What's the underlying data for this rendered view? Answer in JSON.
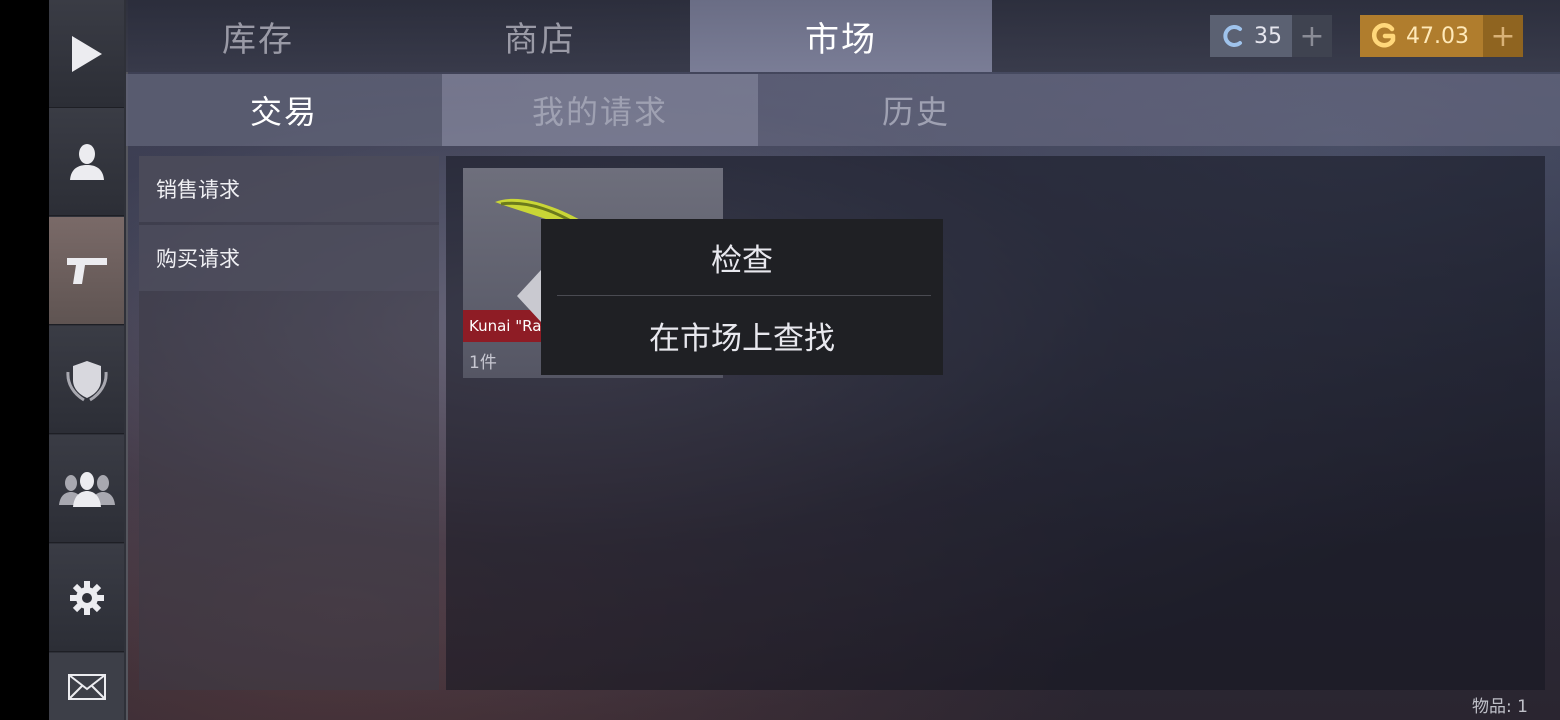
{
  "top_tabs": [
    {
      "label": "库存"
    },
    {
      "label": "商店"
    },
    {
      "label": "市场"
    }
  ],
  "currency": {
    "credits": {
      "value": "35",
      "plus": "+"
    },
    "gold": {
      "value": "47.03",
      "plus": "+"
    }
  },
  "sub_tabs": [
    {
      "label": "交易"
    },
    {
      "label": "我的请求"
    },
    {
      "label": "历史"
    }
  ],
  "sidebar": {
    "icons": [
      "play-icon",
      "profile-icon",
      "pistol-icon",
      "clan-shield-icon",
      "friends-icon",
      "settings-gear-icon",
      "mail-icon"
    ],
    "active_index": 2
  },
  "left_list": [
    {
      "label": "销售请求"
    },
    {
      "label": "购买请求"
    }
  ],
  "item_card": {
    "name": "Kunai \"Ra",
    "count": "1件"
  },
  "context_menu": {
    "items": [
      {
        "label": "检查"
      },
      {
        "label": "在市场上查找"
      }
    ]
  },
  "footer": {
    "item_count": "物品: 1"
  },
  "colors": {
    "accent_gold": "#b07d2d",
    "rarity_red": "#8e1c25",
    "active_tab": "#7a7d96"
  }
}
